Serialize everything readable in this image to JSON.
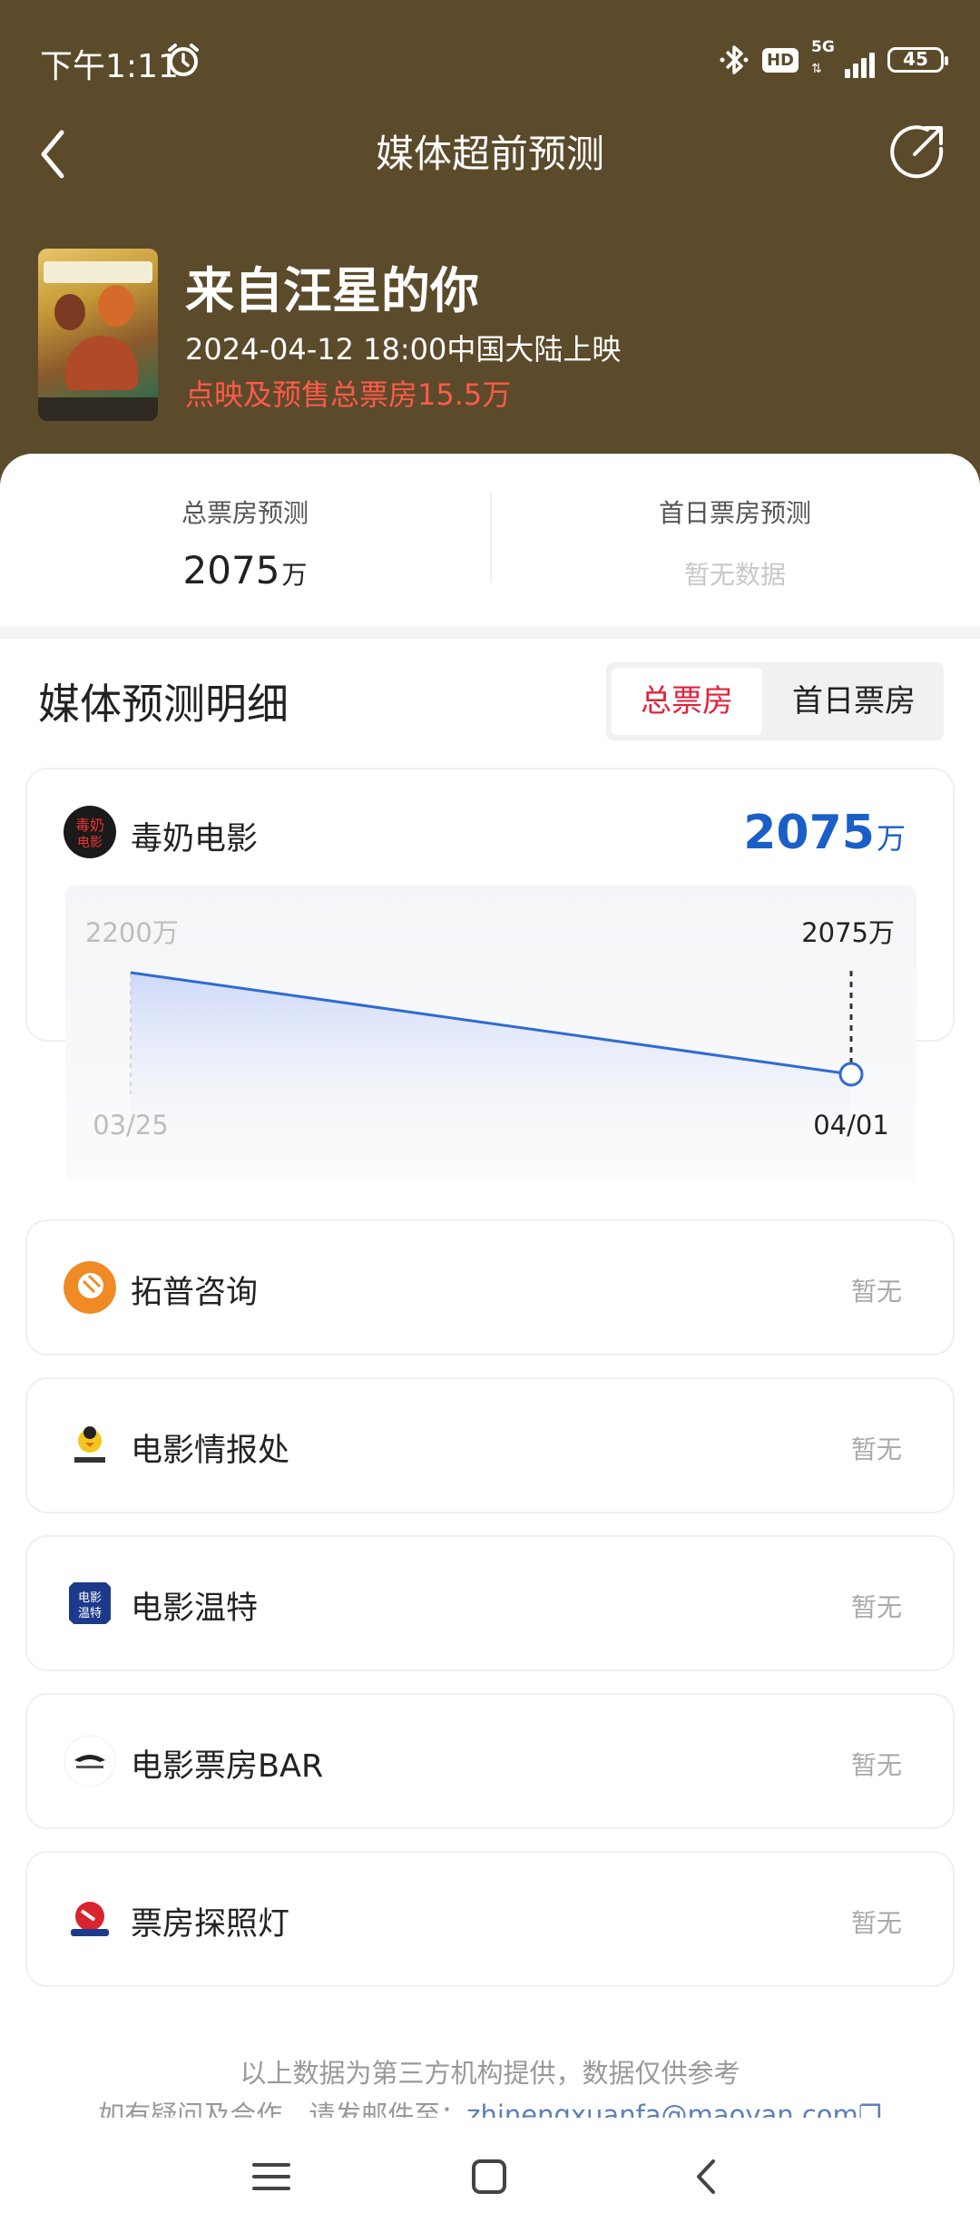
{
  "status_bar": {
    "time": "下午1:11",
    "network": "5G",
    "hd": "HD",
    "battery": "45"
  },
  "nav": {
    "title": "媒体超前预测"
  },
  "movie": {
    "title": "来自汪星的你",
    "release": "2024-04-12 18:00中国大陆上映",
    "presale": "点映及预售总票房15.5万"
  },
  "summary": {
    "total_label": "总票房预测",
    "total_value": "2075",
    "total_unit": "万",
    "first_day_label": "首日票房预测",
    "first_day_value": "暂无数据"
  },
  "detail": {
    "title": "媒体预测明细",
    "tabs": [
      "总票房",
      "首日票房"
    ],
    "active_tab": 0
  },
  "main_org": {
    "name": "毒奶电影",
    "value": "2075",
    "unit": "万",
    "accent": "#1a5fc8"
  },
  "chart_data": {
    "type": "line",
    "x": [
      "03/25",
      "04/01"
    ],
    "series": [
      {
        "values": [
          2200,
          2075
        ]
      }
    ],
    "point_labels": [
      "2200万",
      "2075万"
    ],
    "unit": "万"
  },
  "orgs": [
    {
      "name": "拓普咨询",
      "status": "暂无",
      "icon": "tuopu-logo-icon"
    },
    {
      "name": "电影情报处",
      "status": "暂无",
      "icon": "chick-logo-icon"
    },
    {
      "name": "电影温特",
      "status": "暂无",
      "icon": "wente-logo-icon"
    },
    {
      "name": "电影票房BAR",
      "status": "暂无",
      "icon": "bar-logo-icon"
    },
    {
      "name": "票房探照灯",
      "status": "暂无",
      "icon": "searchlight-logo-icon"
    }
  ],
  "footer": {
    "note": "以上数据为第三方机构提供，数据仅供参考",
    "contact_prefix": "如有疑问及合作，请发邮件至：",
    "email": "zhinengxuanfa@maoyan.com"
  },
  "colors": {
    "header": "#5b4b2b",
    "highlight": "#e0233b",
    "presale": "#ff5a4a"
  }
}
